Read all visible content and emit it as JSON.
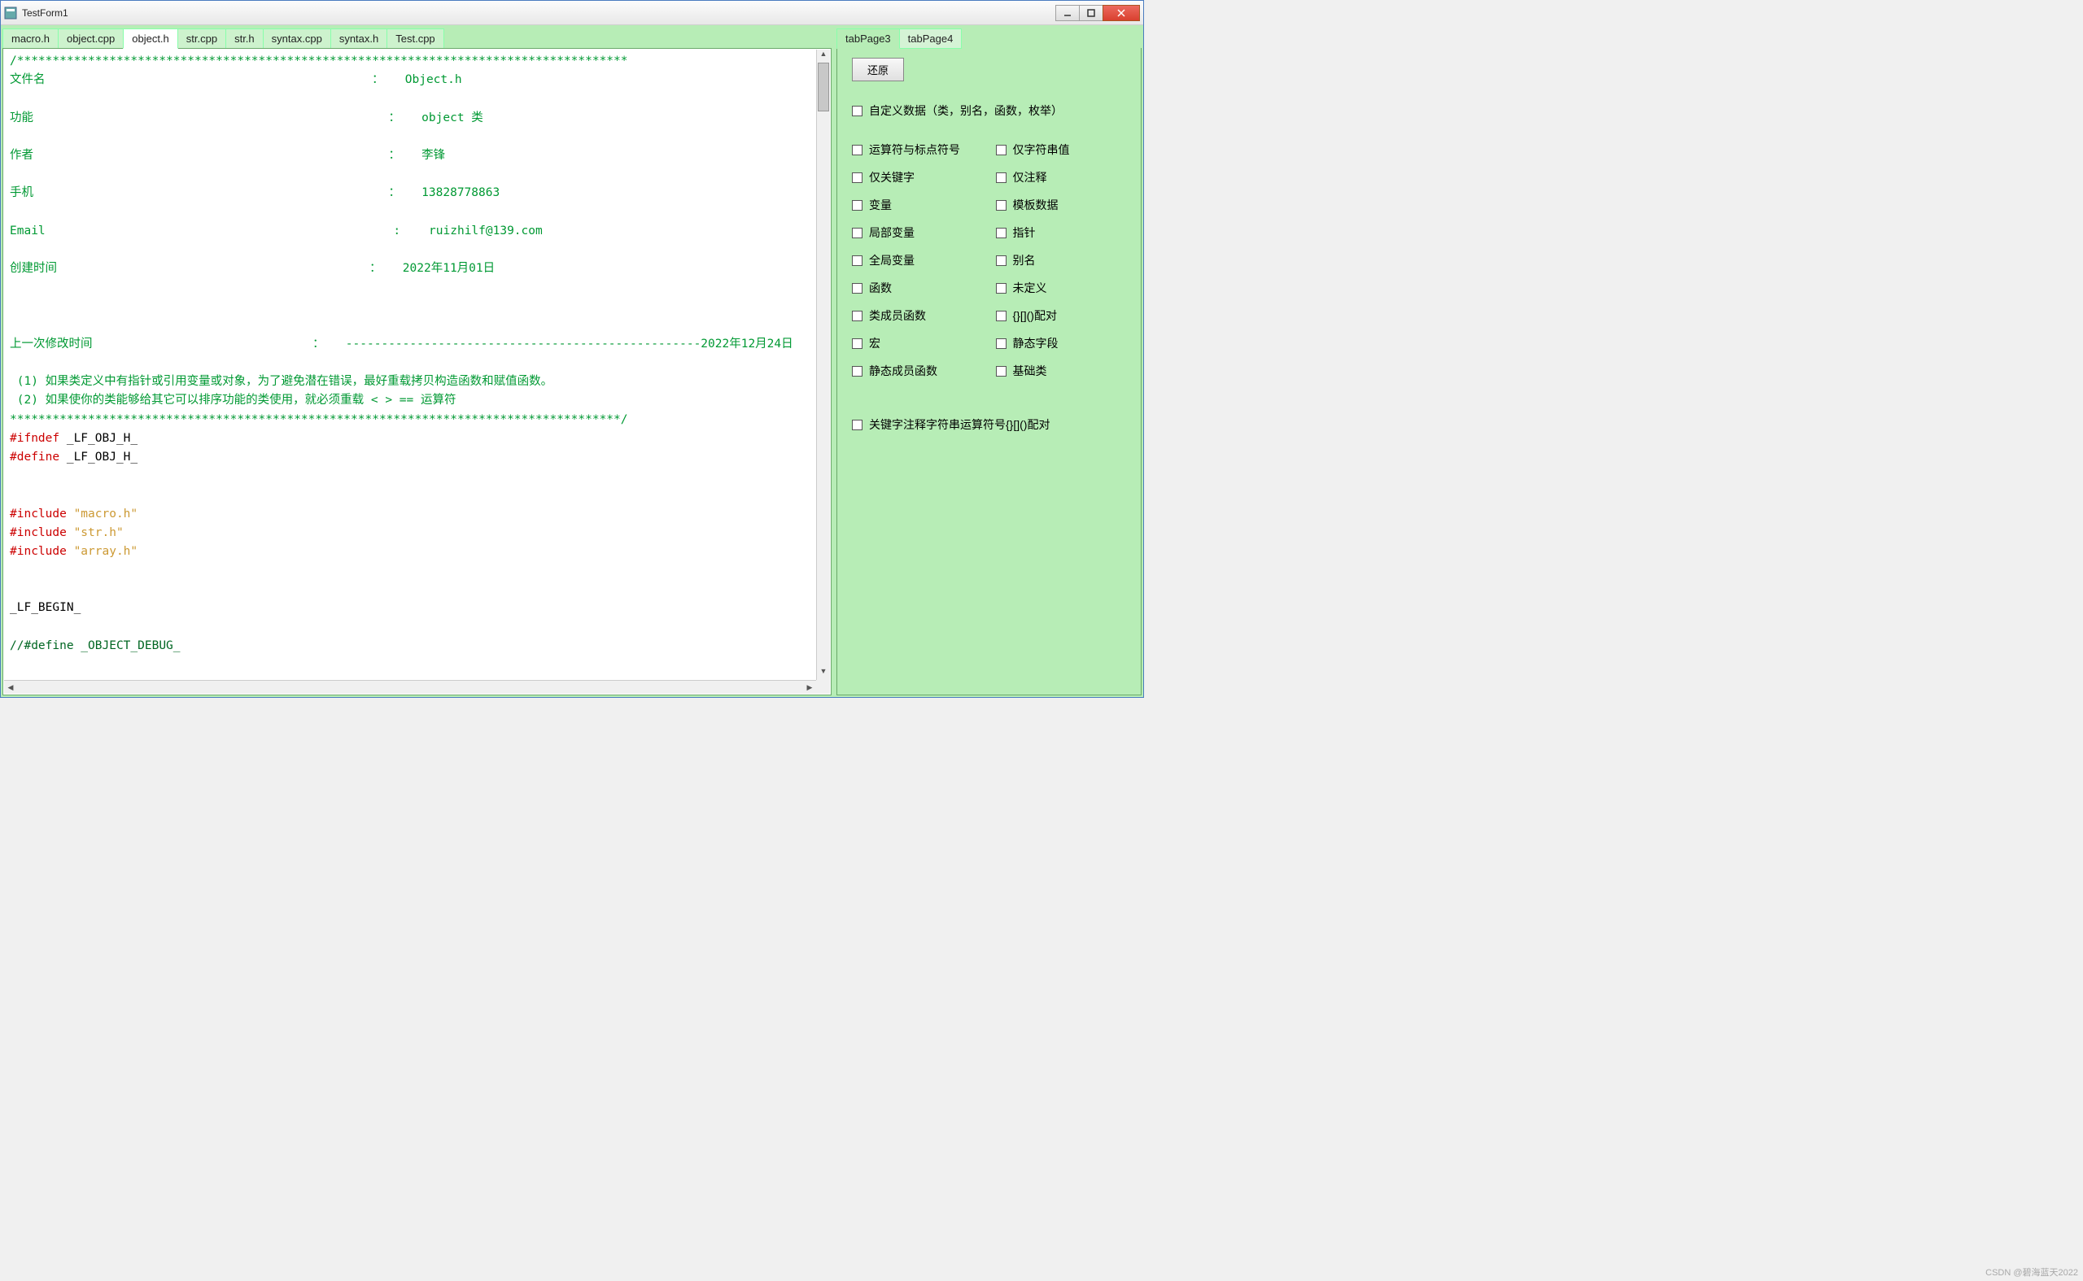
{
  "window": {
    "title": "TestForm1"
  },
  "left_tabs": [
    {
      "label": "macro.h",
      "active": false
    },
    {
      "label": "object.cpp",
      "active": false
    },
    {
      "label": "object.h",
      "active": true
    },
    {
      "label": "str.cpp",
      "active": false
    },
    {
      "label": "str.h",
      "active": false
    },
    {
      "label": "syntax.cpp",
      "active": false
    },
    {
      "label": "syntax.h",
      "active": false
    },
    {
      "label": "Test.cpp",
      "active": false
    }
  ],
  "right_tabs": [
    {
      "label": "tabPage3",
      "active": true
    },
    {
      "label": "tabPage4",
      "active": false
    }
  ],
  "button_restore": "还原",
  "checkboxes_top": [
    "自定义数据（类，别名，函数，枚举）"
  ],
  "checkbox_pairs": [
    [
      "运算符与标点符号",
      "仅字符串值"
    ],
    [
      "仅关键字",
      "仅注释"
    ],
    [
      "变量",
      "模板数据"
    ],
    [
      "局部变量",
      "指针"
    ],
    [
      "全局变量",
      "别名"
    ],
    [
      "函数",
      "未定义"
    ],
    [
      "类成员函数",
      "{}[]()配对"
    ],
    [
      "宏",
      "静态字段"
    ],
    [
      "静态成员函数",
      "基础类"
    ]
  ],
  "checkboxes_bottom": [
    "关键字注释字符串运算符号{}[]()配对"
  ],
  "code": {
    "hdr_star1": "/**************************************************************************************",
    "l_file": "文件名                                              ：   Object.h",
    "l_func": "功能                                                  ：   object 类",
    "l_auth": "作者                                                  ：   李锋",
    "l_phone": "手机                                                  ：   13828778863",
    "l_email": "Email                                                 :    ruizhilf@139.com",
    "l_create": "创建时间                                            ：   2022年11月01日",
    "l_mod": "上一次修改时间                               ：   --------------------------------------------------2022年12月24日",
    "l_note1": " (1) 如果类定义中有指针或引用变量或对象，为了避免潜在错误，最好重载拷贝构造函数和赋值函数。",
    "l_note2": " (2) 如果使你的类能够给其它可以排序功能的类使用，就必须重载 < > == 运算符",
    "hdr_star2": "**************************************************************************************/",
    "ifndef": "#ifndef",
    "ifndef_s": " _LF_OBJ_H_",
    "define": "#define",
    "define_s": " _LF_OBJ_H_",
    "inc": "#include",
    "inc1": " \"macro.h\"",
    "inc2": " \"str.h\"",
    "inc3": " \"array.h\"",
    "lf_begin": "_LF_BEGIN_",
    "dbgdef": "//#define _OBJECT_DEBUG_"
  },
  "watermark": "CSDN @碧海蓝天2022"
}
